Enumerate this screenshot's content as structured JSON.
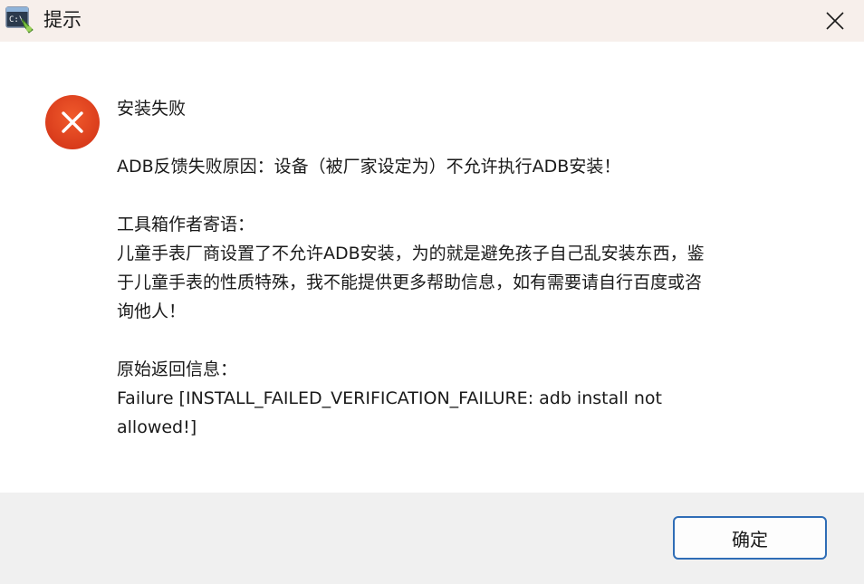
{
  "window": {
    "title": "提示"
  },
  "dialog": {
    "icon": "error-icon",
    "heading": "安装失败",
    "reason": "ADB反馈失败原因：设备（被厂家设定为）不允许执行ADB安装！",
    "note_title": "工具箱作者寄语：",
    "note_line1": "儿童手表厂商设置了不允许ADB安装，为的就是避免孩子自己乱安装东西，鉴",
    "note_line2": "于儿童手表的性质特殊，我不能提供更多帮助信息，如有需要请自行百度或咨",
    "note_line3": "询他人！",
    "raw_title": "原始返回信息：",
    "raw_line1": "Failure [INSTALL_FAILED_VERIFICATION_FAILURE: adb install not",
    "raw_line2": "allowed!]"
  },
  "footer": {
    "ok_label": "确定"
  },
  "colors": {
    "titlebar_bg": "#f7efeb",
    "error_red": "#e0431e",
    "button_border": "#2f6db6",
    "footer_bg": "#f0f0f0"
  }
}
